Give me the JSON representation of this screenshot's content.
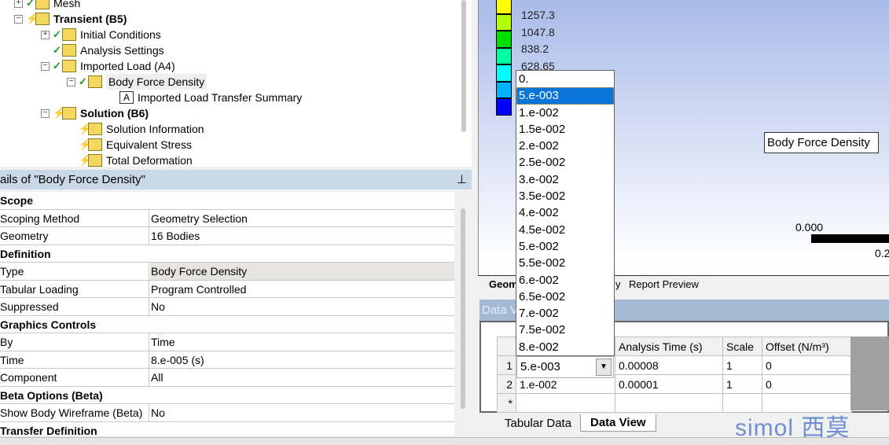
{
  "tree": {
    "items": [
      {
        "label": "Mesh",
        "status": "check",
        "expander": "+",
        "level": 0,
        "bold": false
      },
      {
        "label": "Transient (B5)",
        "status": "bolt",
        "expander": "-",
        "level": 0,
        "bold": true
      },
      {
        "label": "Initial Conditions",
        "status": "check",
        "expander": "+",
        "level": 1,
        "bold": false
      },
      {
        "label": "Analysis Settings",
        "status": "check",
        "expander": "",
        "level": 1,
        "bold": false
      },
      {
        "label": "Imported Load (A4)",
        "status": "check",
        "expander": "-",
        "level": 1,
        "bold": false
      },
      {
        "label": "Body Force Density",
        "status": "check",
        "expander": "-",
        "level": 2,
        "bold": false,
        "selected": true
      },
      {
        "label": "Imported Load Transfer Summary",
        "status": "",
        "expander": "",
        "level": 3,
        "bold": false
      },
      {
        "label": "Solution (B6)",
        "status": "bolt",
        "expander": "-",
        "level": 1,
        "bold": true
      },
      {
        "label": "Solution Information",
        "status": "bolt",
        "expander": "",
        "level": 2,
        "bold": false
      },
      {
        "label": "Equivalent Stress",
        "status": "bolt",
        "expander": "",
        "level": 2,
        "bold": false
      },
      {
        "label": "Total Deformation",
        "status": "bolt",
        "expander": "",
        "level": 2,
        "bold": false
      }
    ]
  },
  "details": {
    "title": "ails of \"Body Force Density\"",
    "pin_icon": "pin-icon",
    "rows": [
      {
        "cat": "Scope"
      },
      {
        "k": "Scoping Method",
        "v": "Geometry Selection"
      },
      {
        "k": "Geometry",
        "v": "16 Bodies"
      },
      {
        "cat": "Definition"
      },
      {
        "k": "Type",
        "v": "Body Force Density",
        "hl": true
      },
      {
        "k": "Tabular Loading",
        "v": "Program Controlled"
      },
      {
        "k": "Suppressed",
        "v": "No"
      },
      {
        "cat": "Graphics Controls"
      },
      {
        "k": "By",
        "v": "Time"
      },
      {
        "k": "Time",
        "v": "8.e-005 (s)"
      },
      {
        "k": "Component",
        "v": "All"
      },
      {
        "cat": "Beta Options (Beta)"
      },
      {
        "k": "Show Body Wireframe (Beta)",
        "v": "No"
      },
      {
        "cat": "Transfer Definition"
      }
    ]
  },
  "viewport": {
    "legend": {
      "labels": [
        "1257.3",
        "1047.8",
        "838.2",
        "628.65"
      ],
      "colors": [
        "#ffff00",
        "#b4ff00",
        "#00e000",
        "#00ffa0",
        "#00ffff",
        "#00b0ff",
        "#0000ff"
      ]
    },
    "callout": "Body Force Density",
    "scale_left": "0.000",
    "scale_right": "0.2",
    "tabs": [
      "Geom",
      "y",
      "Report Preview"
    ]
  },
  "data_view": {
    "title": "Data V",
    "columns": [
      "",
      "Analysis Time (s)",
      "Scale",
      "Offset (N/m³)"
    ],
    "rows": [
      {
        "n": "1",
        "src": "5.e-003",
        "time": "0.00008",
        "scale": "1",
        "offset": "0"
      },
      {
        "n": "2",
        "src": "1.e-002",
        "time": "0.00001",
        "scale": "1",
        "offset": "0"
      },
      {
        "n": "*",
        "src": "",
        "time": "",
        "scale": "",
        "offset": ""
      }
    ],
    "dropdown": {
      "options": [
        "0.",
        "5.e-003",
        "1.e-002",
        "1.5e-002",
        "2.e-002",
        "2.5e-002",
        "3.e-002",
        "3.5e-002",
        "4.e-002",
        "4.5e-002",
        "5.e-002",
        "5.5e-002",
        "6.e-002",
        "6.5e-002",
        "7.e-002",
        "7.5e-002",
        "8.e-002"
      ],
      "selected": "5.e-003"
    }
  },
  "bottom_tabs": [
    "Tabular Data",
    "Data View"
  ],
  "active_bottom_tab": "Data View",
  "logo": "simol 西莫"
}
